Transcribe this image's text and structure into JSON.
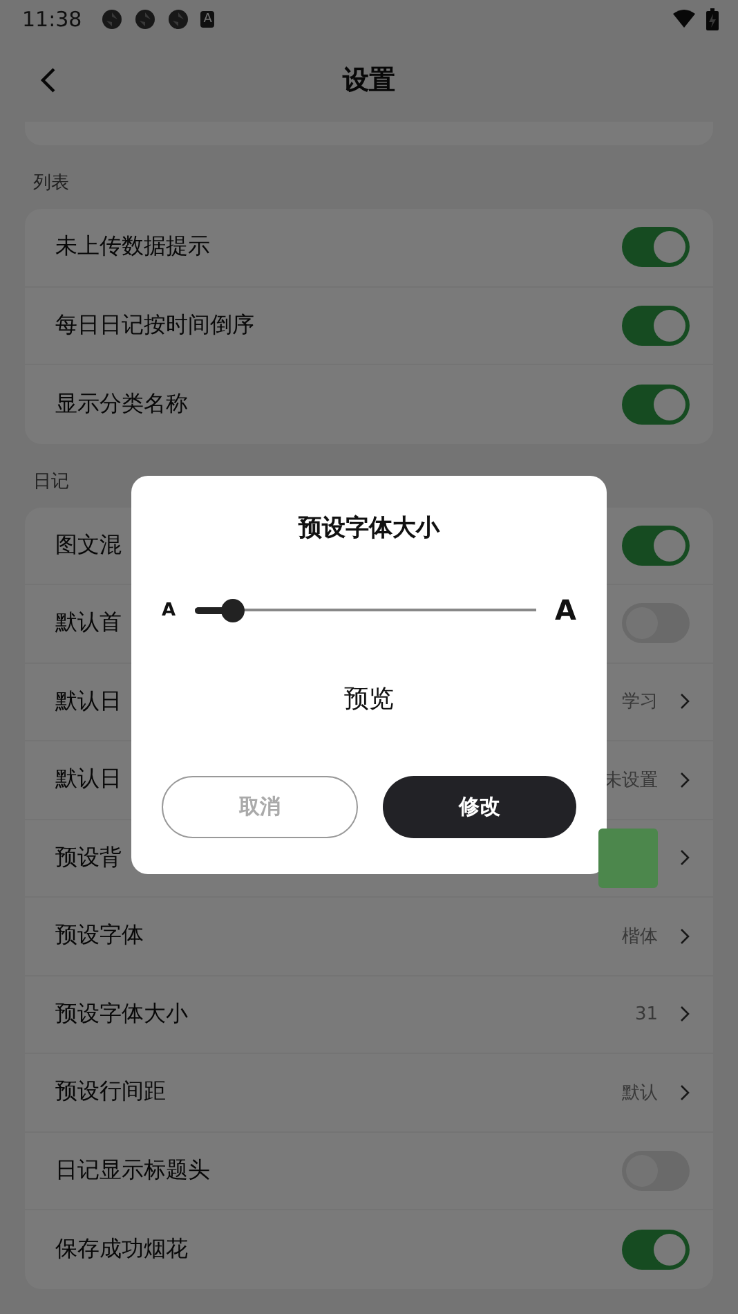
{
  "status_bar": {
    "time": "11:38",
    "badge": "A"
  },
  "header": {
    "title": "设置"
  },
  "sections": [
    {
      "title": "列表",
      "rows": [
        {
          "kind": "toggle",
          "label": "未上传数据提示",
          "on": true
        },
        {
          "kind": "toggle",
          "label": "每日日记按时间倒序",
          "on": true
        },
        {
          "kind": "toggle",
          "label": "显示分类名称",
          "on": true
        }
      ]
    },
    {
      "title": "日记",
      "rows": [
        {
          "kind": "toggle",
          "label": "图文混",
          "on": true
        },
        {
          "kind": "toggle",
          "label": "默认首",
          "on": false
        },
        {
          "kind": "value",
          "label": "默认日",
          "value": "学习"
        },
        {
          "kind": "value",
          "label": "默认日",
          "value": "未设置"
        },
        {
          "kind": "swatch",
          "label": "预设背",
          "color": "#4c874c"
        },
        {
          "kind": "value",
          "label": "预设字体",
          "value": "楷体"
        },
        {
          "kind": "value",
          "label": "预设字体大小",
          "value": "31"
        },
        {
          "kind": "value",
          "label": "预设行间距",
          "value": "默认"
        },
        {
          "kind": "toggle",
          "label": "日记显示标题头",
          "on": false
        },
        {
          "kind": "toggle",
          "label": "保存成功烟花",
          "on": true
        }
      ]
    }
  ],
  "dialog": {
    "title": "预设字体大小",
    "small_label": "A",
    "large_label": "A",
    "slider": {
      "level": 0.11
    },
    "preview": "预览",
    "buttons": [
      {
        "kind": "secondary",
        "label": "取消"
      },
      {
        "kind": "primary",
        "label": "修改"
      }
    ]
  }
}
